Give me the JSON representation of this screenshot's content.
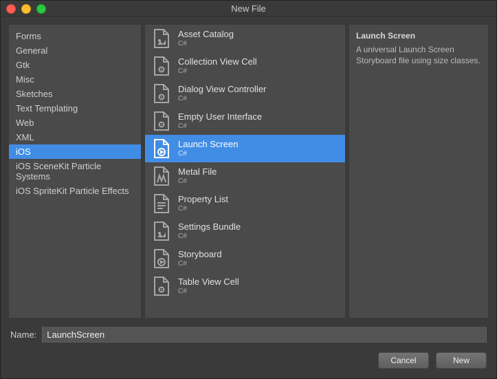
{
  "window": {
    "title": "New File"
  },
  "categories": [
    "Forms",
    "General",
    "Gtk",
    "Misc",
    "Sketches",
    "Text Templating",
    "Web",
    "XML",
    "iOS",
    "iOS SceneKit Particle Systems",
    "iOS SpriteKit Particle Effects"
  ],
  "selectedCategoryIndex": 8,
  "templates": [
    {
      "label": "Asset Catalog",
      "lang": "C#",
      "icon": "assets"
    },
    {
      "label": "Collection View Cell",
      "lang": "C#",
      "icon": "ui"
    },
    {
      "label": "Dialog View Controller",
      "lang": "C#",
      "icon": "ui"
    },
    {
      "label": "Empty User Interface",
      "lang": "C#",
      "icon": "ui"
    },
    {
      "label": "Launch Screen",
      "lang": "C#",
      "icon": "storyboard"
    },
    {
      "label": "Metal File",
      "lang": "C#",
      "icon": "metal"
    },
    {
      "label": "Property List",
      "lang": "C#",
      "icon": "text"
    },
    {
      "label": "Settings Bundle",
      "lang": "C#",
      "icon": "assets"
    },
    {
      "label": "Storyboard",
      "lang": "C#",
      "icon": "storyboard"
    },
    {
      "label": "Table View Cell",
      "lang": "C#",
      "icon": "ui"
    }
  ],
  "selectedTemplateIndex": 4,
  "details": {
    "title": "Launch Screen",
    "text": "A universal Launch Screen Storyboard file using size classes."
  },
  "nameField": {
    "label": "Name:",
    "value": "LaunchScreen"
  },
  "buttons": {
    "cancel": "Cancel",
    "new": "New"
  }
}
